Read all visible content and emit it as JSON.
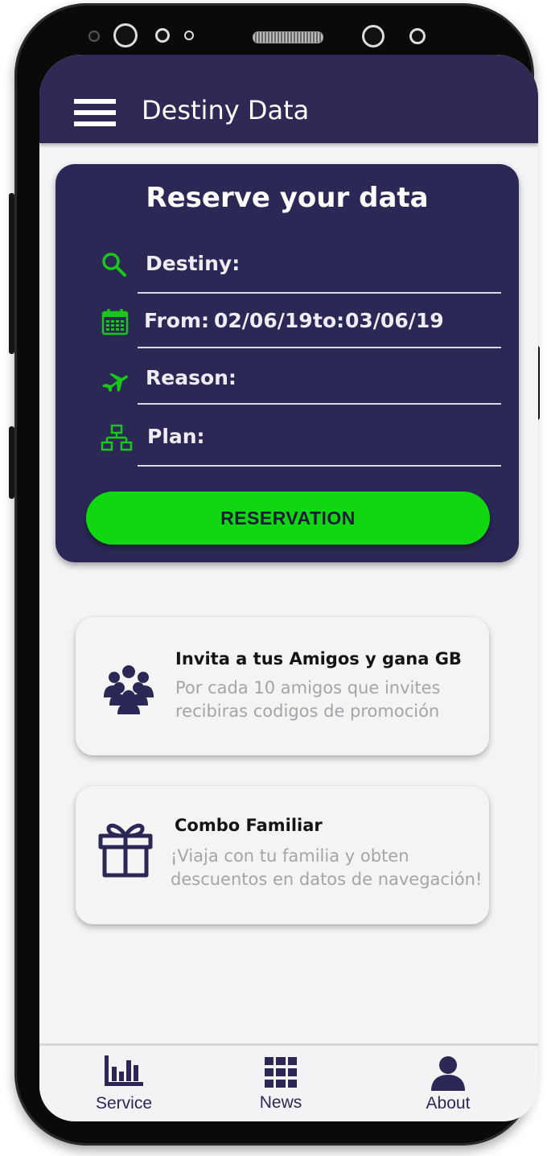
{
  "app": {
    "title": "Destiny Data"
  },
  "reservation": {
    "heading": "Reserve your data",
    "destiny_label": "Destiny:",
    "from_label": "From:",
    "from_date": "02/06/19",
    "to_label": "to:",
    "to_date": "03/06/19",
    "reason_label": "Reason:",
    "plan_label": "Plan:",
    "button_label": "RESERVATION"
  },
  "promos": [
    {
      "title": "Invita a tus Amigos y gana GB",
      "line1": "Por cada 10 amigos que invites",
      "line2": "recibiras codigos de promoción",
      "icon": "group-icon"
    },
    {
      "title": "Combo Familiar",
      "line1": "¡Viaja con tu familia y obten",
      "line2": "descuentos en datos de navegación!",
      "icon": "gift-icon"
    }
  ],
  "nav": [
    {
      "label": "Service",
      "icon": "bar-chart-icon"
    },
    {
      "label": "News",
      "icon": "grid-icon"
    },
    {
      "label": "About",
      "icon": "user-icon"
    }
  ],
  "colors": {
    "primary": "#2b2855",
    "accent": "#10d810",
    "icon_green": "#18c818",
    "background": "#f4f4f6"
  }
}
